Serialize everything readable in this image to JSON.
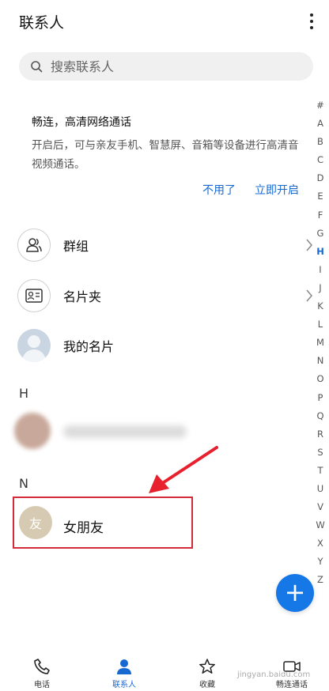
{
  "header": {
    "title": "联系人",
    "more_icon": "more-vertical-icon"
  },
  "search": {
    "placeholder": "搜索联系人",
    "icon": "search-icon"
  },
  "promo": {
    "title": "畅连，高清网络通话",
    "description": "开启后，可与亲友手机、智慧屏、音箱等设备进行高清音视频通话。",
    "decline_label": "不用了",
    "enable_label": "立即开启",
    "accent_color": "#1769d1"
  },
  "groups": [
    {
      "label": "群组",
      "icon": "group-icon"
    },
    {
      "label": "名片夹",
      "icon": "card-holder-icon"
    },
    {
      "label": "我的名片",
      "icon": "avatar-placeholder-icon"
    }
  ],
  "sections": [
    {
      "letter": "H"
    },
    {
      "letter": "N",
      "contact": {
        "avatar_text": "友",
        "name": "女朋友"
      }
    }
  ],
  "index_letters": [
    "#",
    "A",
    "B",
    "C",
    "D",
    "E",
    "F",
    "G",
    "H",
    "I",
    "J",
    "K",
    "L",
    "M",
    "N",
    "O",
    "P",
    "Q",
    "R",
    "S",
    "T",
    "U",
    "V",
    "W",
    "X",
    "Y",
    "Z"
  ],
  "index_active": "H",
  "fab": {
    "label": "+",
    "color": "#1677e6"
  },
  "highlight_color": "#d42a39",
  "bottom_nav": [
    {
      "label": "电话",
      "icon": "phone-icon"
    },
    {
      "label": "联系人",
      "icon": "contacts-icon",
      "active": true
    },
    {
      "label": "收藏",
      "icon": "star-icon"
    },
    {
      "label": "畅连通话",
      "icon": "video-call-icon"
    }
  ],
  "watermark": "jingyan.baidu.com"
}
